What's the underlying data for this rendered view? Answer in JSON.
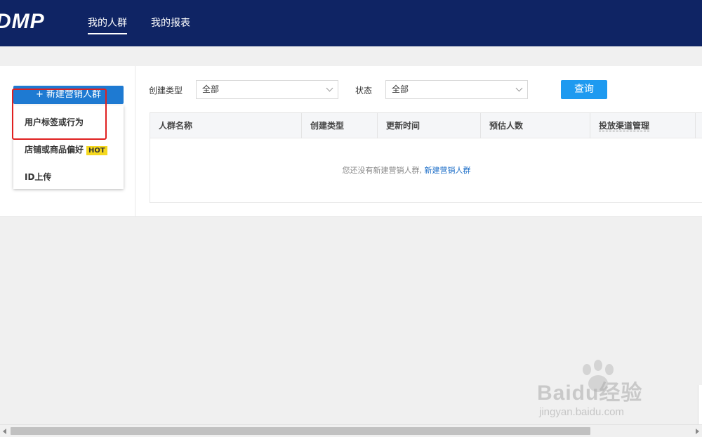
{
  "header": {
    "logo": "DMP",
    "nav": [
      {
        "label": "我的人群",
        "active": true
      },
      {
        "label": "我的报表",
        "active": false
      }
    ],
    "background_color": "#0f2464"
  },
  "sidebar": {
    "new_button": "+ 新建营销人群",
    "menu": [
      {
        "label": "用户标签或行为"
      },
      {
        "label": "店铺或商品偏好",
        "badge": "HOT"
      },
      {
        "label": "ID上传"
      }
    ],
    "highlight_color": "#e02020"
  },
  "filters": {
    "create_type_label": "创建类型",
    "create_type_value": "全部",
    "status_label": "状态",
    "status_value": "全部",
    "query_button": "查询"
  },
  "table": {
    "columns": [
      "人群名称",
      "创建类型",
      "更新时间",
      "预估人数",
      "投放渠道管理"
    ],
    "empty_text": "您还没有新建营销人群,",
    "empty_link": "新建营销人群"
  },
  "watermark": {
    "text": "Baidu经验",
    "url": "jingyan.baidu.com"
  },
  "colors": {
    "accent": "#1e7ad2",
    "query": "#1e9af0",
    "hot_badge": "#f5d81e"
  }
}
